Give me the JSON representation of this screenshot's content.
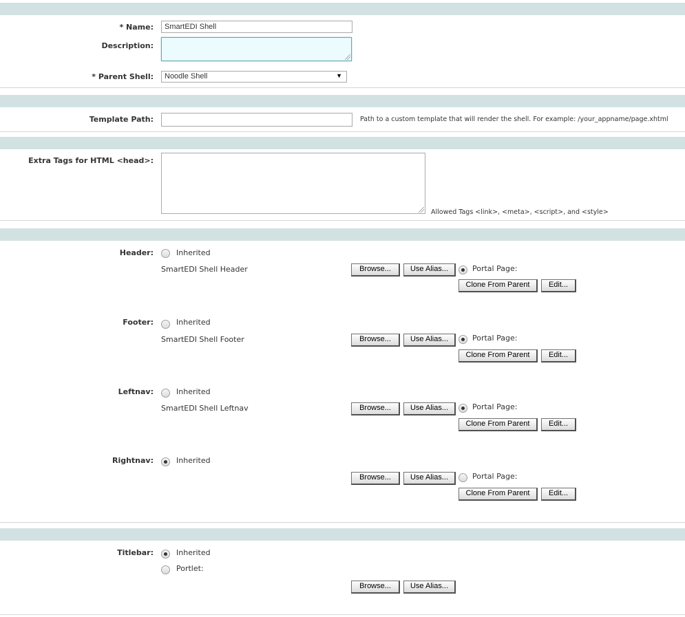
{
  "general": {
    "name_label": "* Name:",
    "name_value": "SmartEDI Shell",
    "description_label": "Description:",
    "description_value": "",
    "parent_label": "* Parent Shell:",
    "parent_value": "Noodle Shell"
  },
  "template": {
    "label": "Template Path:",
    "value": "",
    "hint": "Path to a custom template that will render the shell. For example: /your_appname/page.xhtml"
  },
  "extra_tags": {
    "label": "Extra Tags for HTML <head>:",
    "value": "",
    "hint": "Allowed Tags <link>, <meta>, <script>, and <style>"
  },
  "components": [
    {
      "label": "Header:",
      "inherited_label": "Inherited",
      "inherited_selected": false,
      "page_name": "SmartEDI Shell Header",
      "portal_label": "Portal Page:",
      "portal_selected": true
    },
    {
      "label": "Footer:",
      "inherited_label": "Inherited",
      "inherited_selected": false,
      "page_name": "SmartEDI Shell Footer",
      "portal_label": "Portal Page:",
      "portal_selected": true
    },
    {
      "label": "Leftnav:",
      "inherited_label": "Inherited",
      "inherited_selected": false,
      "page_name": "SmartEDI Shell Leftnav",
      "portal_label": "Portal Page:",
      "portal_selected": true
    },
    {
      "label": "Rightnav:",
      "inherited_label": "Inherited",
      "inherited_selected": true,
      "page_name": "",
      "portal_label": "Portal Page:",
      "portal_selected": false
    }
  ],
  "buttons": {
    "browse": "Browse...",
    "use_alias": "Use Alias...",
    "clone": "Clone From Parent",
    "edit": "Edit..."
  },
  "titlebar": {
    "label": "Titlebar:",
    "inherited_label": "Inherited",
    "inherited_selected": true,
    "portlet_label": "Portlet:",
    "portlet_selected": false
  }
}
